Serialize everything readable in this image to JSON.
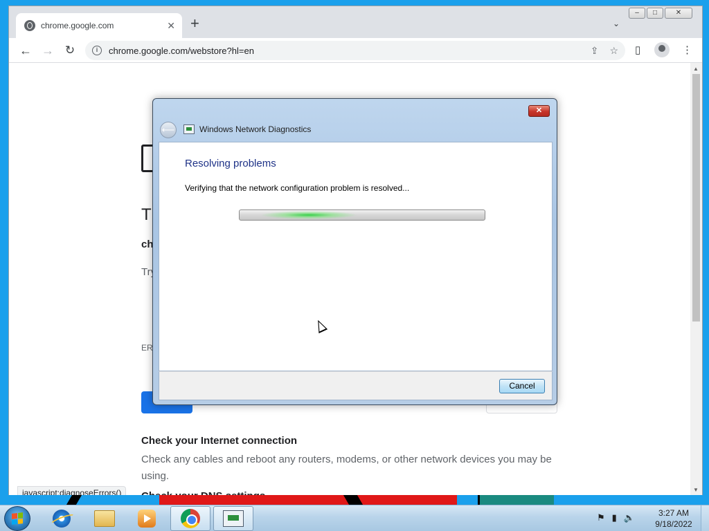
{
  "browser": {
    "tab_title": "chrome.google.com",
    "tab_close": "✕",
    "new_tab": "+",
    "tab_search": "⌄",
    "window_minimize": "–",
    "window_maximize": "□",
    "window_close": "✕",
    "back": "←",
    "forward": "→",
    "reload": "↻",
    "info": "i",
    "url": "chrome.google.com/webstore?hl=en",
    "share": "⇪",
    "bookmark": "☆",
    "side_panel": "▯",
    "menu": "⋮"
  },
  "page": {
    "heading": "Tl",
    "subheading": "ch",
    "try_text": "Try",
    "error_code": "ERR",
    "check_title": "Check your Internet connection",
    "check_body": "Check any cables and reboot any routers, modems, or other network devices you may be using.",
    "next_heading": "Check your DNS settings",
    "status_url": "javascript:diagnoseErrors()"
  },
  "dialog": {
    "title": "Windows Network Diagnostics",
    "close": "✕",
    "back": "⟵",
    "heading": "Resolving problems",
    "message": "Verifying that the network configuration problem is resolved...",
    "cancel": "Cancel"
  },
  "taskbar": {
    "time": "3:27 AM",
    "date": "9/18/2022",
    "tray_flag": "⚑",
    "tray_network": "▮",
    "tray_volume": "🔈",
    "start_colors": [
      "#f35325",
      "#81bc06",
      "#05a6f0",
      "#ffba08"
    ]
  },
  "colors": {
    "chrome_blue": "#1a73e8",
    "dialog_heading": "#1e3287",
    "progress_green": "#38d04a"
  },
  "icons": [
    "globe-icon",
    "info-icon",
    "share-icon",
    "star-icon",
    "side-panel-icon",
    "profile-icon",
    "menu-icon",
    "network-diagnostics-icon",
    "ie-icon",
    "folder-icon",
    "media-player-icon",
    "chrome-icon",
    "flag-icon",
    "network-icon",
    "volume-icon",
    "windows-logo-icon"
  ]
}
